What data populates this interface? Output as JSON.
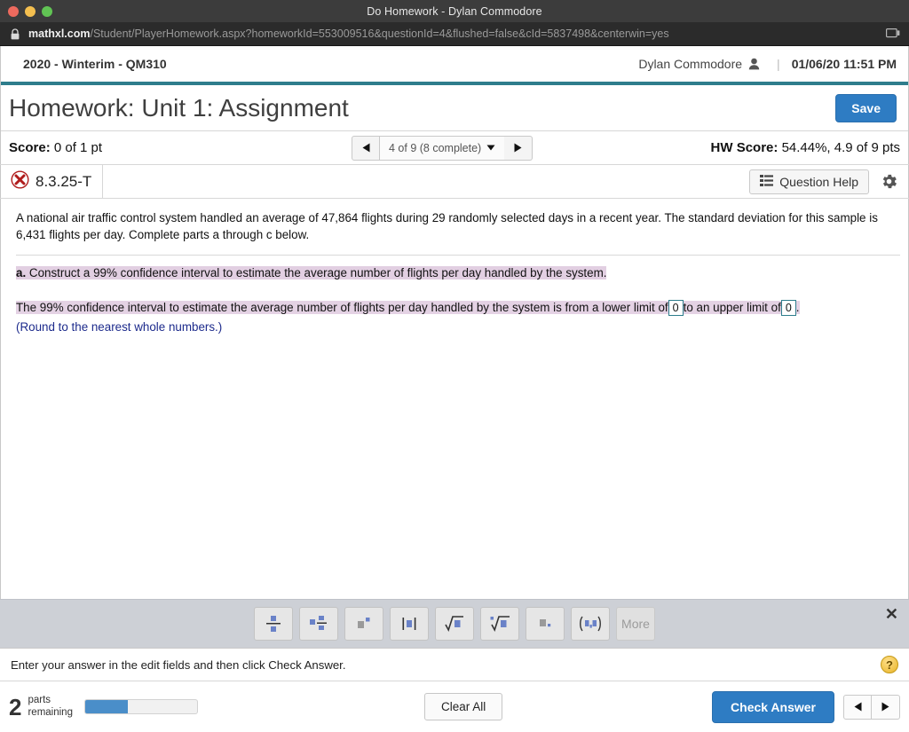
{
  "window": {
    "title": "Do Homework - Dylan Commodore",
    "traffic_lights": [
      "close-red",
      "minimize-yellow",
      "maximize-green"
    ]
  },
  "browser": {
    "lock_icon": "lock-icon",
    "url_domain": "mathxl.com",
    "url_path": "/Student/PlayerHomework.aspx?homeworkId=553009516&questionId=4&flushed=false&cId=5837498&centerwin=yes",
    "cast_icon": "screen-cast-icon"
  },
  "course_bar": {
    "course": "2020 - Winterim - QM310",
    "user": "Dylan Commodore",
    "user_icon": "person-icon",
    "separator": "|",
    "datetime": "01/06/20 11:51 PM"
  },
  "title_row": {
    "title": "Homework: Unit 1: Assignment",
    "save_label": "Save"
  },
  "score_row": {
    "score_label": "Score:",
    "score_value": "0 of 1 pt",
    "prev_icon": "triangle-left-icon",
    "next_icon": "triangle-right-icon",
    "question_selector": "4 of 9 (8 complete)",
    "caret_icon": "caret-down-icon",
    "hw_score_label": "HW Score:",
    "hw_score_value": "54.44%, 4.9 of 9 pts"
  },
  "question_header": {
    "status_icon": "incorrect-x-circle-icon",
    "question_id": "8.3.25-T",
    "question_help_label": "Question Help",
    "question_help_icon": "list-lines-icon",
    "gear_icon": "gear-icon"
  },
  "question": {
    "stem": "A national air traffic control system handled an average of 47,864 flights during 29 randomly selected days in a recent year. The standard deviation for this sample is 6,431 flights per day. Complete parts a through c below.",
    "part_label": "a.",
    "part_text": "Construct a 99% confidence interval to estimate the average number of flights per day handled by the system.",
    "answer_text_1": "The 99% confidence interval to estimate the average number of flights per day handled by the system is from a lower limit of",
    "answer_text_2": "to an upper limit of",
    "answer_text_3": ".",
    "lower_limit_value": "0",
    "upper_limit_value": "0",
    "round_note": "(Round to the nearest whole numbers.)"
  },
  "palette": {
    "close_icon": "close-x-icon",
    "buttons": [
      {
        "name": "fraction-button",
        "glyph": "fraction"
      },
      {
        "name": "mixed-fraction-button",
        "glyph": "mixed-fraction"
      },
      {
        "name": "exponent-button",
        "glyph": "exponent"
      },
      {
        "name": "absolute-value-button",
        "glyph": "absolute-value"
      },
      {
        "name": "square-root-button",
        "glyph": "square-root"
      },
      {
        "name": "nth-root-button",
        "glyph": "nth-root"
      },
      {
        "name": "decimal-button",
        "glyph": "decimal"
      },
      {
        "name": "ordered-pair-button",
        "glyph": "ordered-pair"
      }
    ],
    "more_label": "More"
  },
  "instruction": {
    "text": "Enter your answer in the edit fields and then click Check Answer.",
    "help_icon": "question-mark-help-icon",
    "help_glyph": "?"
  },
  "footer": {
    "parts_count": "2",
    "parts_label_line1": "parts",
    "parts_label_line2": "remaining",
    "progress_percent": 38,
    "clear_all_label": "Clear All",
    "check_answer_label": "Check Answer",
    "prev_icon": "triangle-left-icon",
    "next_icon": "triangle-right-icon"
  },
  "colors": {
    "accent_blue": "#2e7cc3",
    "teal_rule": "#2e7d8c",
    "highlight_lavender": "#e2cfe2",
    "link_blue": "#1d2b8c",
    "palette_bg": "#cdd0d6"
  }
}
